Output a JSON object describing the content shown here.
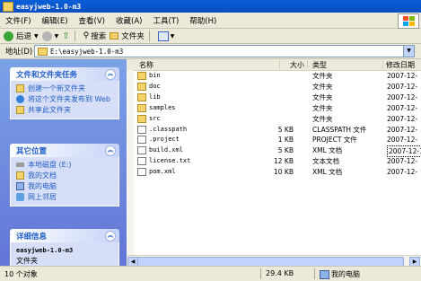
{
  "window": {
    "title": "easyjweb-1.0-m3"
  },
  "menu": [
    "文件(F)",
    "编辑(E)",
    "查看(V)",
    "收藏(A)",
    "工具(T)",
    "帮助(H)"
  ],
  "toolbar": {
    "back": "后退",
    "search": "搜索",
    "folders": "文件夹"
  },
  "address": {
    "label": "地址(D)",
    "value": "E:\\easyjweb-1.0-m3"
  },
  "tasks": {
    "title": "文件和文件夹任务",
    "items": [
      "创建一个新文件夹",
      "将这个文件夹发布到 Web",
      "共享此文件夹"
    ]
  },
  "other_places": {
    "title": "其它位置",
    "items": [
      "本地磁盘 (E:)",
      "我的文档",
      "我的电脑",
      "网上邻居"
    ]
  },
  "details": {
    "title": "详细信息",
    "name": "easyjweb-1.0-m3",
    "type": "文件夹"
  },
  "columns": {
    "name": "名称",
    "size": "大小",
    "type": "类型",
    "date": "修改日期"
  },
  "files": [
    {
      "name": "bin",
      "size": "",
      "type": "文件夹",
      "date": "2007-12-",
      "kind": "folder"
    },
    {
      "name": "doc",
      "size": "",
      "type": "文件夹",
      "date": "2007-12-",
      "kind": "folder"
    },
    {
      "name": "lib",
      "size": "",
      "type": "文件夹",
      "date": "2007-12-",
      "kind": "folder"
    },
    {
      "name": "samples",
      "size": "",
      "type": "文件夹",
      "date": "2007-12-",
      "kind": "folder"
    },
    {
      "name": "src",
      "size": "",
      "type": "文件夹",
      "date": "2007-12-",
      "kind": "folder"
    },
    {
      "name": ".classpath",
      "size": "5 KB",
      "type": "CLASSPATH 文件",
      "date": "2007-12-",
      "kind": "doc"
    },
    {
      "name": ".project",
      "size": "1 KB",
      "type": "PROJECT 文件",
      "date": "2007-12-",
      "kind": "doc"
    },
    {
      "name": "build.xml",
      "size": "5 KB",
      "type": "XML 文档",
      "date": "2007-12-1",
      "kind": "doc"
    },
    {
      "name": "license.txt",
      "size": "12 KB",
      "type": "文本文档",
      "date": "2007-12-",
      "kind": "doc"
    },
    {
      "name": "pom.xml",
      "size": "10 KB",
      "type": "XML 文档",
      "date": "2007-12-",
      "kind": "doc"
    }
  ],
  "status": {
    "count": "10 个对象",
    "size": "29.4 KB",
    "location": "我的电脑"
  }
}
